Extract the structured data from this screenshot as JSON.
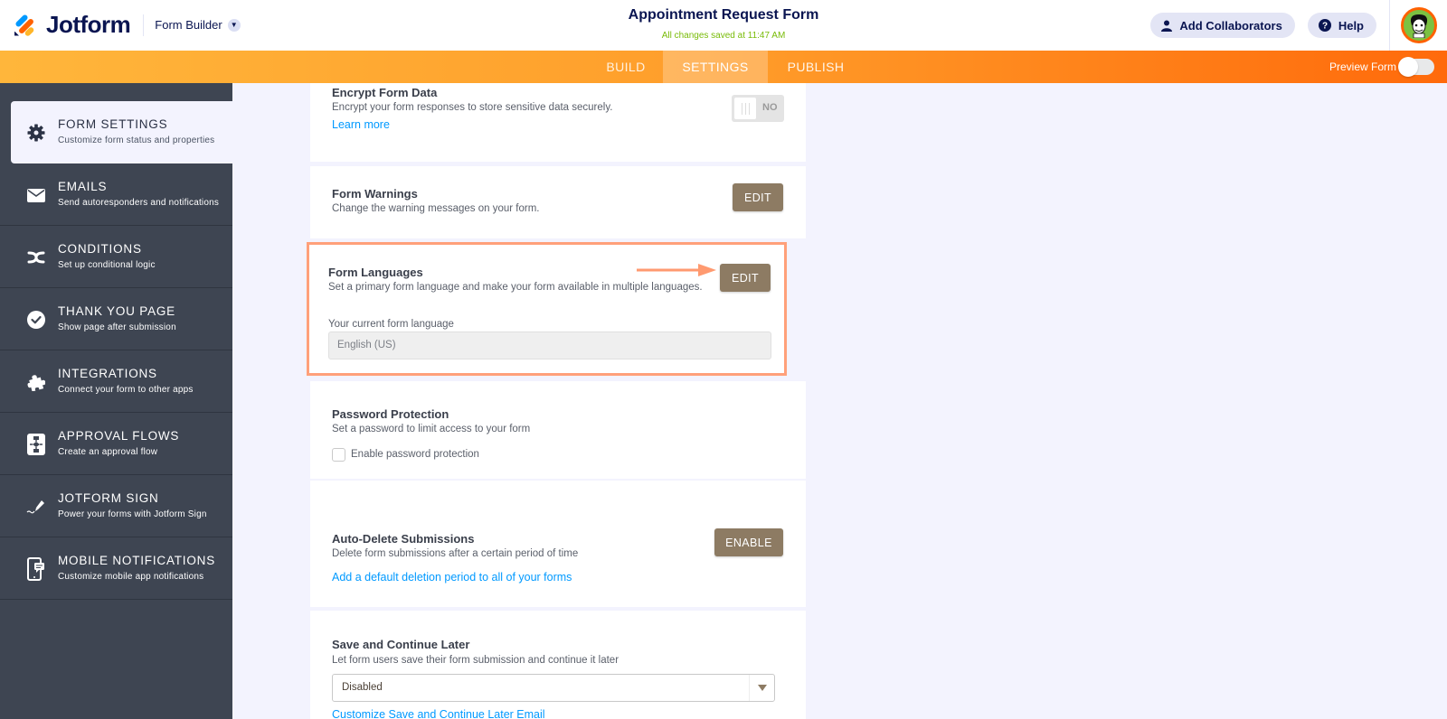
{
  "header": {
    "logo_text": "Jotform",
    "builder_label": "Form Builder",
    "form_title": "Appointment Request Form",
    "saved_status": "All changes saved at 11:47 AM",
    "add_collaborators_label": "Add Collaborators",
    "help_label": "Help"
  },
  "navbar": {
    "tabs": [
      {
        "label": "BUILD",
        "active": false
      },
      {
        "label": "SETTINGS",
        "active": true
      },
      {
        "label": "PUBLISH",
        "active": false
      }
    ],
    "preview_label": "Preview Form",
    "preview_on": false
  },
  "sidebar": {
    "items": [
      {
        "title": "FORM SETTINGS",
        "subtitle": "Customize form status and properties",
        "icon": "gear-icon",
        "active": true
      },
      {
        "title": "EMAILS",
        "subtitle": "Send autoresponders and notifications",
        "icon": "envelope-icon"
      },
      {
        "title": "CONDITIONS",
        "subtitle": "Set up conditional logic",
        "icon": "shuffle-icon"
      },
      {
        "title": "THANK YOU PAGE",
        "subtitle": "Show page after submission",
        "icon": "check-circle-icon"
      },
      {
        "title": "INTEGRATIONS",
        "subtitle": "Connect your form to other apps",
        "icon": "puzzle-icon"
      },
      {
        "title": "APPROVAL FLOWS",
        "subtitle": "Create an approval flow",
        "icon": "flowchart-icon"
      },
      {
        "title": "JOTFORM SIGN",
        "subtitle": "Power your forms with Jotform Sign",
        "icon": "pen-sign-icon"
      },
      {
        "title": "MOBILE NOTIFICATIONS",
        "subtitle": "Customize mobile app notifications",
        "icon": "mobile-message-icon"
      }
    ]
  },
  "settings": {
    "encrypt": {
      "title": "Encrypt Form Data",
      "description": "Encrypt your form responses to store sensitive data securely.",
      "link": "Learn more",
      "toggle_label": "NO"
    },
    "warnings": {
      "title": "Form Warnings",
      "description": "Change the warning messages on your form.",
      "button": "EDIT"
    },
    "languages": {
      "title": "Form Languages",
      "description": "Set a primary form language and make your form available in multiple languages.",
      "button": "EDIT",
      "current_label": "Your current form language",
      "current_value": "English (US)"
    },
    "password": {
      "title": "Password Protection",
      "description": "Set a password to limit access to your form",
      "checkbox_label": "Enable password protection",
      "checked": false
    },
    "auto_delete": {
      "title": "Auto-Delete Submissions",
      "description": "Delete form submissions after a certain period of time",
      "button": "ENABLE",
      "link": "Add a default deletion period to all of your forms"
    },
    "save_continue": {
      "title": "Save and Continue Later",
      "description": "Let form users save their form submission and continue it later",
      "selected": "Disabled",
      "link": "Customize Save and Continue Later Email"
    }
  },
  "colors": {
    "accent_orange": "#ff6100",
    "button_brown": "#8d7b63",
    "link_blue": "#0099ff",
    "highlight_border": "#ffa07a",
    "sidebar_bg": "#3e4552",
    "saved_green": "#78bb07"
  }
}
